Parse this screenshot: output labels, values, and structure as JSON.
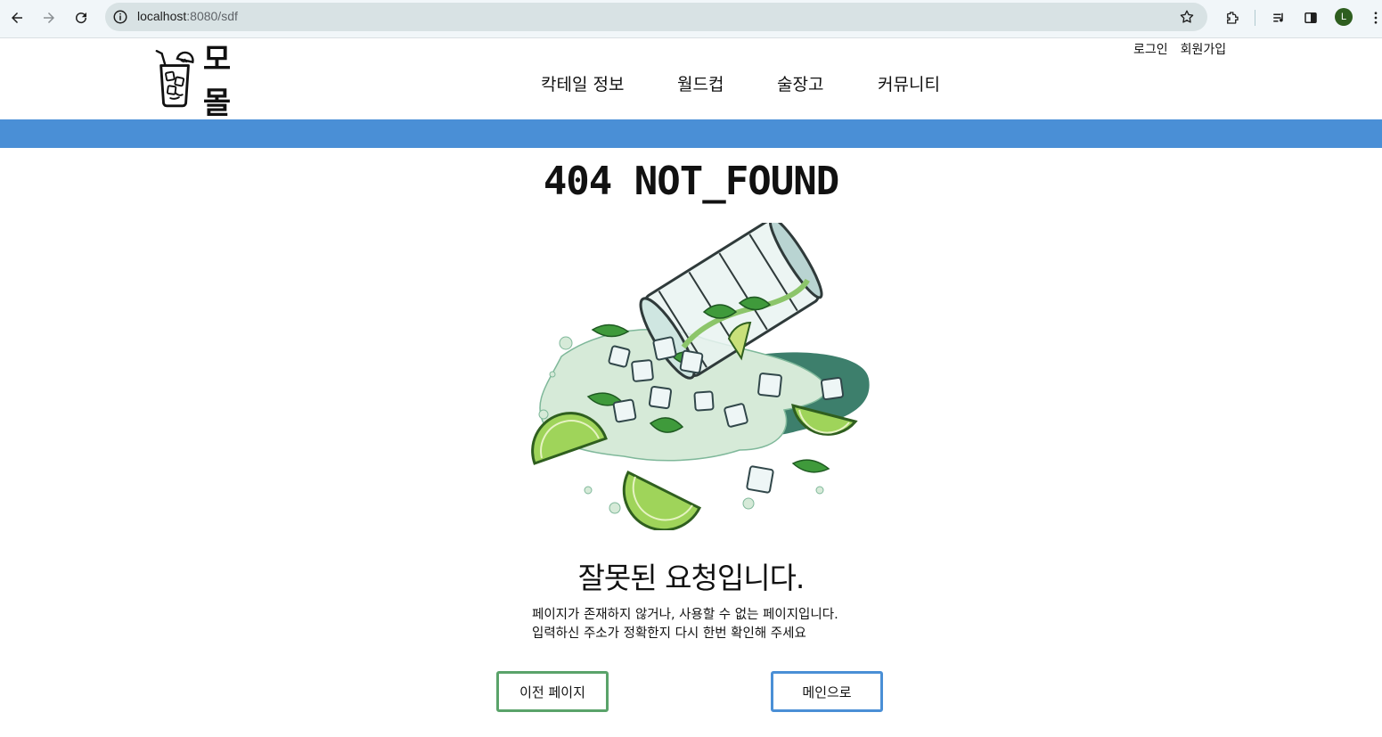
{
  "browser": {
    "url_host": "localhost",
    "url_path": ":8080/sdf",
    "profile_initial": "L"
  },
  "header": {
    "login": "로그인",
    "signup": "회원가입",
    "logo_text": "모몰",
    "nav": [
      "칵테일 정보",
      "월드컵",
      "술장고",
      "커뮤니티"
    ],
    "band_color": "#4a8fd6"
  },
  "content": {
    "error_title": "404 NOT_FOUND",
    "illustration": "spilled-mojito-glass",
    "subtitle": "잘못된 요청입니다.",
    "desc_line1": "페이지가 존재하지 않거나, 사용할 수 없는 페이지입니다.",
    "desc_line2": "입력하신 주소가 정확한지 다시 한번 확인해 주세요"
  },
  "buttons": {
    "prev": "이전 페이지",
    "main": "메인으로",
    "prev_color": "#5aa36a",
    "main_color": "#4a8fd6"
  }
}
